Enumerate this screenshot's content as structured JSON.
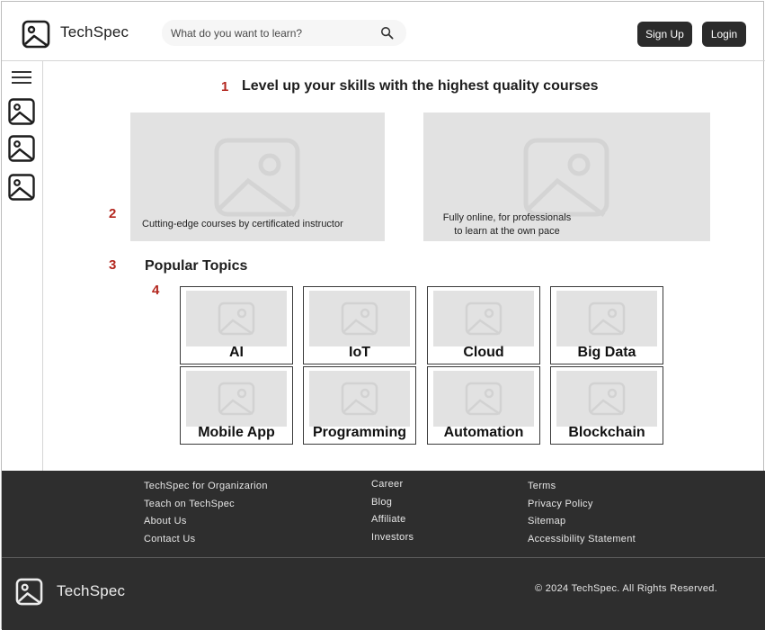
{
  "header": {
    "brand": "TechSpec",
    "search_placeholder": "What do you want to learn?",
    "signup_label": "Sign Up",
    "login_label": "Login"
  },
  "markers": [
    "1",
    "2",
    "3",
    "4"
  ],
  "main": {
    "headline": "Level up your skills with the highest quality courses",
    "hero": [
      {
        "caption": "Cutting-edge courses by certificated instructor"
      },
      {
        "caption_line1": "Fully online, for professionals",
        "caption_line2": "to learn at the own pace"
      }
    ],
    "popular_title": "Popular Topics",
    "topics": [
      "AI",
      "IoT",
      "Cloud",
      "Big Data",
      "Mobile App",
      "Programming",
      "Automation",
      "Blockchain"
    ]
  },
  "footer": {
    "col1": [
      "TechSpec for Organizarion",
      "Teach on TechSpec",
      "About Us",
      "Contact Us"
    ],
    "col2": [
      "Career",
      "Blog",
      "Affiliate",
      "Investors"
    ],
    "col3": [
      "Terms",
      "Privacy Policy",
      "Sitemap",
      "Accessibility Statement"
    ],
    "brand": "TechSpec",
    "copyright": "© 2024 TechSpec. All Rights Reserved."
  },
  "colors": {
    "dark": "#2b2b2b",
    "footer_bg": "#2e2e2e",
    "placeholder_gray": "#e2e2e2",
    "marker_red": "#b3261e"
  },
  "icons": {
    "logo": "image-icon",
    "search": "search-icon",
    "menu": "hamburger-menu-icon",
    "sidebar": "image-icon"
  }
}
